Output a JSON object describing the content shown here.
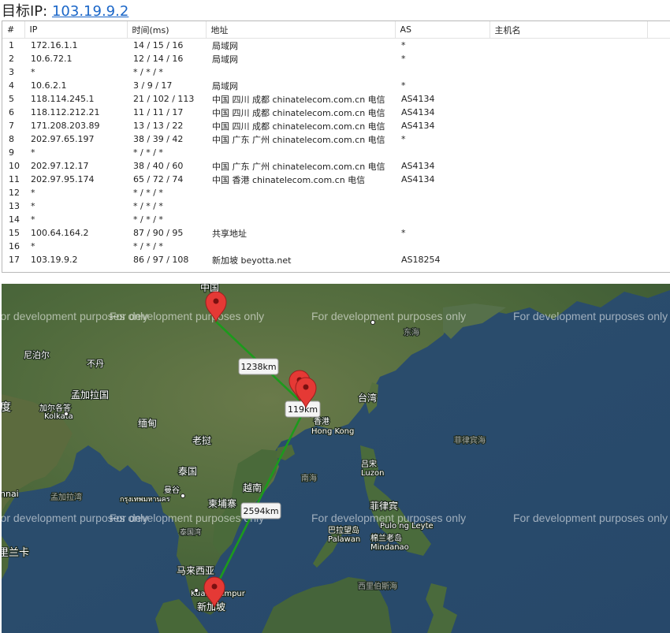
{
  "header": {
    "label": "目标IP:",
    "ip": "103.19.9.2"
  },
  "table": {
    "columns": [
      "#",
      "IP",
      "时间(ms)",
      "地址",
      "AS",
      "主机名"
    ],
    "rows": [
      {
        "n": "1",
        "ip": "172.16.1.1",
        "time": "14 / 15 / 16",
        "addr": "局域网",
        "as": "*",
        "host": ""
      },
      {
        "n": "2",
        "ip": "10.6.72.1",
        "time": "12 / 14 / 16",
        "addr": "局域网",
        "as": "*",
        "host": ""
      },
      {
        "n": "3",
        "ip": "*",
        "time": "* / * / *",
        "addr": "",
        "as": "",
        "host": ""
      },
      {
        "n": "4",
        "ip": "10.6.2.1",
        "time": "3 / 9 / 17",
        "addr": "局域网",
        "as": "*",
        "host": ""
      },
      {
        "n": "5",
        "ip": "118.114.245.1",
        "time": "21 / 102 / 113",
        "addr": "中国 四川 成都 chinatelecom.com.cn 电信",
        "as": "AS4134",
        "host": ""
      },
      {
        "n": "6",
        "ip": "118.112.212.21",
        "time": "11 / 11 / 17",
        "addr": "中国 四川 成都 chinatelecom.com.cn 电信",
        "as": "AS4134",
        "host": ""
      },
      {
        "n": "7",
        "ip": "171.208.203.89",
        "time": "13 / 13 / 22",
        "addr": "中国 四川 成都 chinatelecom.com.cn 电信",
        "as": "AS4134",
        "host": ""
      },
      {
        "n": "8",
        "ip": "202.97.65.197",
        "time": "38 / 39 / 42",
        "addr": "中国 广东 广州 chinatelecom.com.cn 电信",
        "as": "*",
        "host": ""
      },
      {
        "n": "9",
        "ip": "*",
        "time": "* / * / *",
        "addr": "",
        "as": "",
        "host": ""
      },
      {
        "n": "10",
        "ip": "202.97.12.17",
        "time": "38 / 40 / 60",
        "addr": "中国 广东 广州 chinatelecom.com.cn 电信",
        "as": "AS4134",
        "host": ""
      },
      {
        "n": "11",
        "ip": "202.97.95.174",
        "time": "65 / 72 / 74",
        "addr": "中国 香港 chinatelecom.com.cn 电信",
        "as": "AS4134",
        "host": ""
      },
      {
        "n": "12",
        "ip": "*",
        "time": "* / * / *",
        "addr": "",
        "as": "",
        "host": ""
      },
      {
        "n": "13",
        "ip": "*",
        "time": "* / * / *",
        "addr": "",
        "as": "",
        "host": ""
      },
      {
        "n": "14",
        "ip": "*",
        "time": "* / * / *",
        "addr": "",
        "as": "",
        "host": ""
      },
      {
        "n": "15",
        "ip": "100.64.164.2",
        "time": "87 / 90 / 95",
        "addr": "共享地址",
        "as": "*",
        "host": ""
      },
      {
        "n": "16",
        "ip": "*",
        "time": "* / * / *",
        "addr": "",
        "as": "",
        "host": ""
      },
      {
        "n": "17",
        "ip": "103.19.9.2",
        "time": "86 / 97 / 108",
        "addr": "新加坡 beyotta.net",
        "as": "AS18254",
        "host": ""
      }
    ]
  },
  "map": {
    "watermark": "For development purposes only",
    "distances": [
      "1238km",
      "119km",
      "2594km"
    ],
    "places": {
      "china": "中国",
      "nepal": "尼泊尔",
      "bhutan": "不丹",
      "bangladesh": "孟加拉国",
      "kolkata_cn": "加尔各答",
      "kolkata": "Kolkata",
      "india_frag": "度",
      "myanmar": "缅甸",
      "laos": "老挝",
      "thailand": "泰国",
      "vietnam": "越南",
      "cambodia": "柬埔寨",
      "bangkok_cn": "曼谷",
      "bangkok_th": "กรุงเทพมหานคร",
      "gulf_thai": "泰国湾",
      "malaysia": "马来西亚",
      "kl": "Kuala Lumpur",
      "singapore": "新加坡",
      "hk_cn": "香港",
      "hk": "Hong Kong",
      "taiwan": "台湾",
      "east_sea": "东海",
      "south_sea": "南海",
      "philippine_sea": "菲律宾海",
      "luzon_cn": "吕宋",
      "luzon": "Luzon",
      "philippines": "菲律宾",
      "pulo": "Pulo ng Leyte",
      "palawan_cn": "巴拉望岛",
      "palawan": "Palawan",
      "mindanao_cn": "棉兰老岛",
      "mindanao": "Mindanao",
      "celebes": "西里伯斯海",
      "bay_bengal": "孟加拉湾",
      "srilanka": "里兰卡",
      "chennai_frag": "nnai"
    }
  },
  "colors": {
    "link": "#1a66c8",
    "route": "#1c9a1c",
    "pin": "#e53935"
  }
}
